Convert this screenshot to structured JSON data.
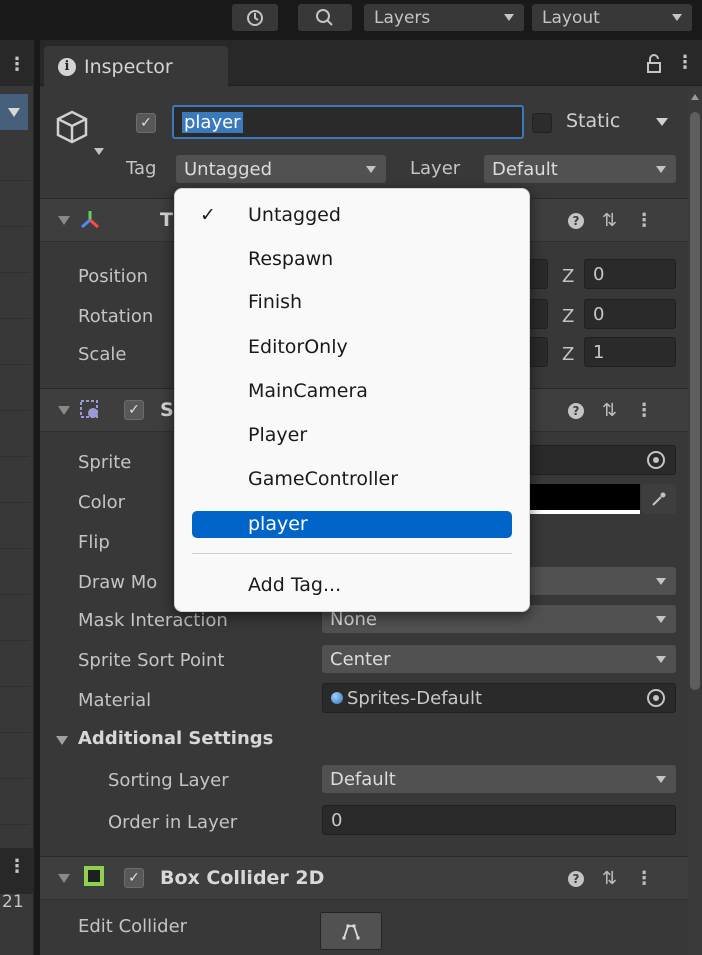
{
  "toolbar": {
    "layers_label": "Layers",
    "layout_label": "Layout"
  },
  "left_panel": {
    "row_number": "21"
  },
  "inspector": {
    "tab_label": "Inspector",
    "object_name": "player",
    "static_label": "Static",
    "tag_label": "Tag",
    "tag_value": "Untagged",
    "layer_label": "Layer",
    "layer_value": "Default"
  },
  "transform": {
    "title_initial": "T",
    "rows": [
      {
        "label": "Position",
        "z_label": "Z",
        "z_value": "0"
      },
      {
        "label": "Rotation",
        "z_label": "Z",
        "z_value": "0"
      },
      {
        "label": "Scale",
        "z_label": "Z",
        "z_value": "1"
      }
    ]
  },
  "sprite_renderer": {
    "title_initial": "S",
    "sprite_label": "Sprite",
    "color_label": "Color",
    "color_value": "#000000",
    "flip_label": "Flip",
    "draw_mode_label": "Draw Mo",
    "mask_label": "Mask Interaction",
    "mask_value": "None",
    "sort_point_label": "Sprite Sort Point",
    "sort_point_value": "Center",
    "material_label": "Material",
    "material_value": "Sprites-Default",
    "additional_label": "Additional Settings",
    "sorting_layer_label": "Sorting Layer",
    "sorting_layer_value": "Default",
    "order_label": "Order in Layer",
    "order_value": "0"
  },
  "box_collider": {
    "title": "Box Collider 2D",
    "edit_label": "Edit Collider",
    "accent_color": "#8fd14f"
  },
  "tag_menu": {
    "items": [
      "Untagged",
      "Respawn",
      "Finish",
      "EditorOnly",
      "MainCamera",
      "Player",
      "GameController",
      "player"
    ],
    "checked": "Untagged",
    "selected": "player",
    "add_label": "Add Tag...",
    "selected_color": "#0064c8"
  }
}
